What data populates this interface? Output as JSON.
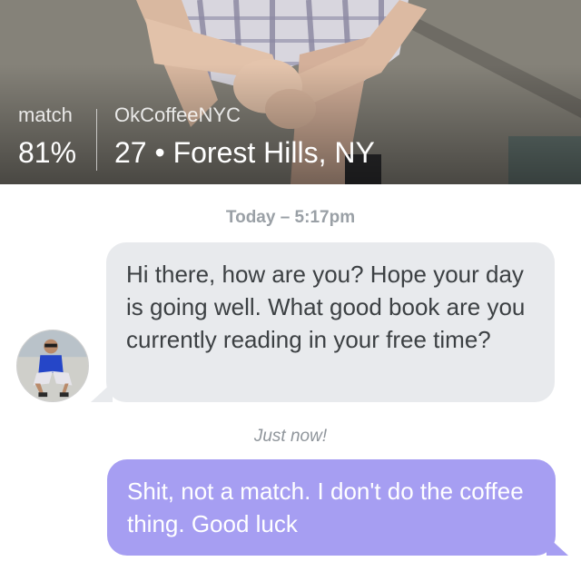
{
  "profile": {
    "match_label": "match",
    "match_value": "81%",
    "username": "OkCoffeeNYC",
    "details": "27 • Forest Hills, NY"
  },
  "conversation": {
    "timestamp_first": "Today – 5:17pm",
    "incoming_message": "Hi there, how are you? Hope your day is going well. What good book are you currently reading in your free time?",
    "timestamp_second": "Just now!",
    "outgoing_message": "Shit, not a match. I don't do the coffee thing. Good luck"
  },
  "colors": {
    "incoming_bubble": "#e8eaed",
    "outgoing_bubble": "#a69ef2",
    "timestamp": "#9aa0a6"
  }
}
